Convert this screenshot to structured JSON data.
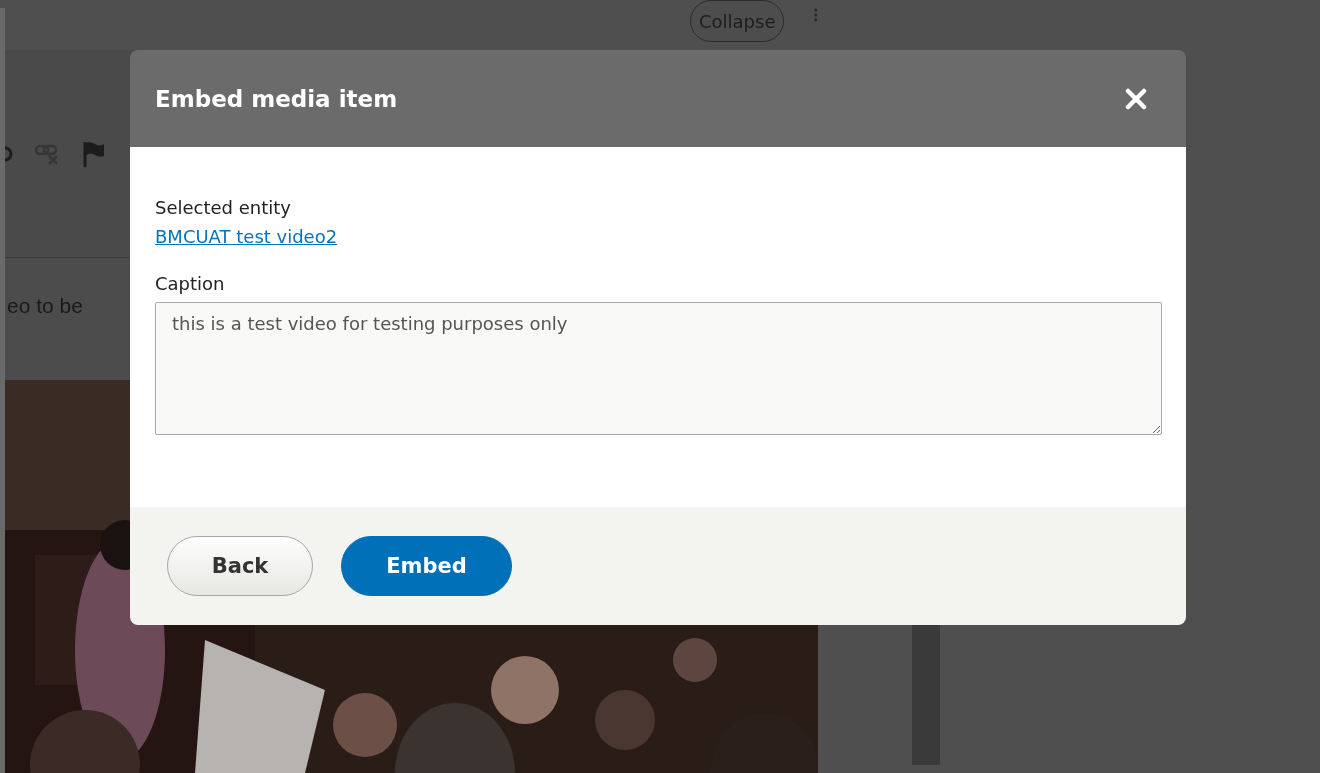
{
  "background": {
    "collapse_button": "Collapse",
    "editor_text": "eo to be"
  },
  "dialog": {
    "title": "Embed media item",
    "selected_entity_label": "Selected entity",
    "selected_entity_link": "BMCUAT test video2",
    "caption_label": "Caption",
    "caption_value": "this is a test video for testing purposes only",
    "buttons": [
      {
        "label": "Back",
        "kind": "secondary"
      },
      {
        "label": "Embed",
        "kind": "primary"
      }
    ]
  }
}
